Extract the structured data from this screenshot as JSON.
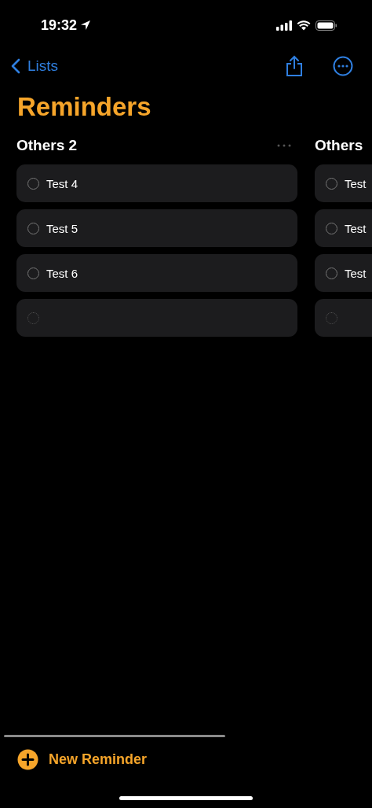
{
  "status_bar": {
    "time": "19:32"
  },
  "nav": {
    "back_label": "Lists"
  },
  "title": "Reminders",
  "columns": [
    {
      "name": "Others 2",
      "items": [
        {
          "kind": "task",
          "title": "Test 4",
          "checked": false
        },
        {
          "kind": "task",
          "title": "Test 5",
          "checked": false
        },
        {
          "kind": "task",
          "title": "Test 6",
          "checked": false
        },
        {
          "kind": "new"
        }
      ]
    },
    {
      "name": "Others",
      "items": [
        {
          "kind": "task",
          "title": "Test",
          "checked": false
        },
        {
          "kind": "task",
          "title": "Test",
          "checked": false
        },
        {
          "kind": "task",
          "title": "Test",
          "checked": false
        },
        {
          "kind": "new"
        }
      ]
    }
  ],
  "new_reminder": "New Reminder"
}
